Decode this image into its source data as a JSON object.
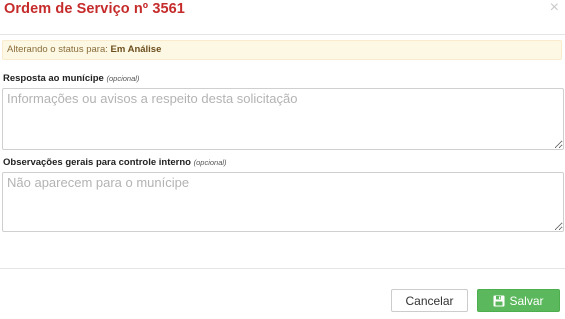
{
  "modal": {
    "title": "Ordem de Serviço nº 3561",
    "close_glyph": "×"
  },
  "alert": {
    "prefix": "Alterando o status para:",
    "status": "Em Análise"
  },
  "fields": {
    "response": {
      "label": "Resposta ao munícipe",
      "optional": "(opcional)",
      "placeholder": "Informações ou avisos a respeito desta solicitação",
      "value": ""
    },
    "observations": {
      "label": "Observações gerais para controle interno",
      "optional": "(opcional)",
      "placeholder": "Não aparecem para o munícipe",
      "value": ""
    }
  },
  "buttons": {
    "cancel_label": "Cancelar",
    "save_label": "Salvar",
    "save_icon": "save-icon"
  },
  "colors": {
    "title": "#c62b2b",
    "alert_bg": "#fcf8e3",
    "save_bg": "#5cb85c"
  }
}
